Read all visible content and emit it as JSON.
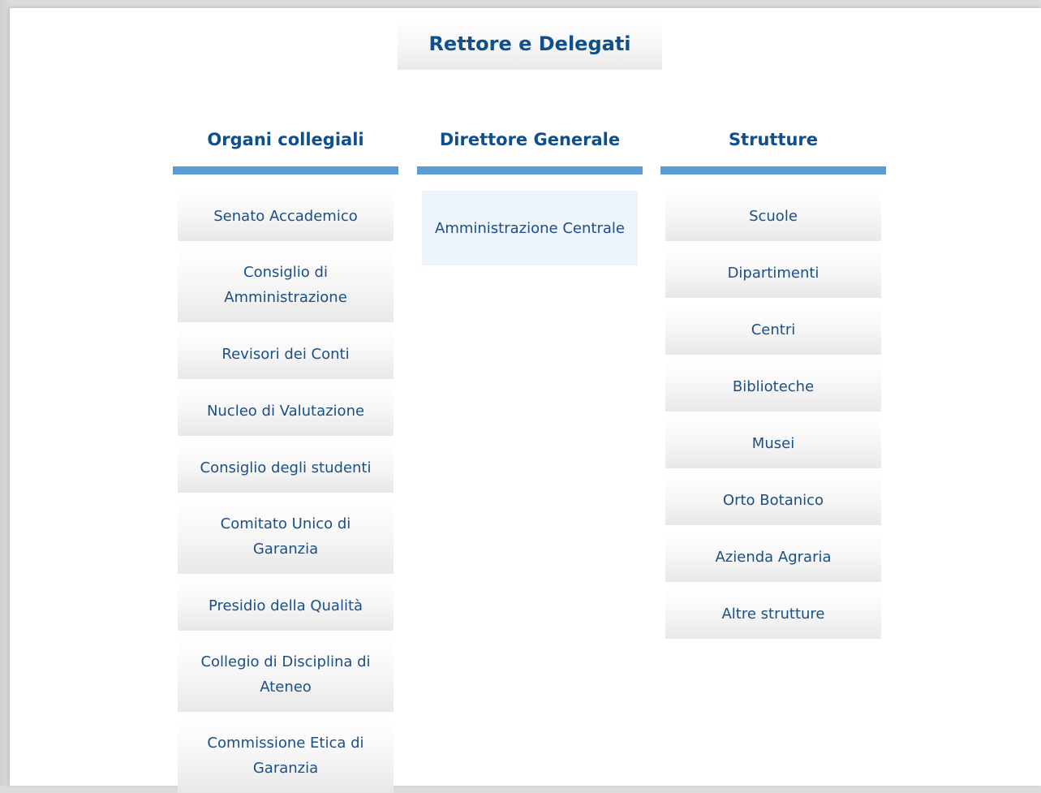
{
  "top": {
    "title": "Rettore e Delegati"
  },
  "columns": [
    {
      "header": "Organi collegiali",
      "items": [
        "Senato Accademico",
        "Consiglio di Amministrazione",
        "Revisori dei Conti",
        "Nucleo di Valutazione",
        "Consiglio degli studenti",
        "Comitato Unico di Garanzia",
        "Presidio della Qualità",
        "Collegio di Disciplina di Ateneo",
        "Commissione Etica di Garanzia"
      ]
    },
    {
      "header": "Direttore Generale",
      "items": [
        "Amministrazione Centrale"
      ]
    },
    {
      "header": "Strutture",
      "items": [
        "Scuole",
        "Dipartimenti",
        "Centri",
        "Biblioteche",
        "Musei",
        "Orto Botanico",
        "Azienda Agraria",
        "Altre strutture"
      ]
    }
  ],
  "colors": {
    "title": "#0f4f8c",
    "link": "#1b4f86",
    "bar": "#5b9bd5",
    "highlight": "#eef4fb"
  }
}
